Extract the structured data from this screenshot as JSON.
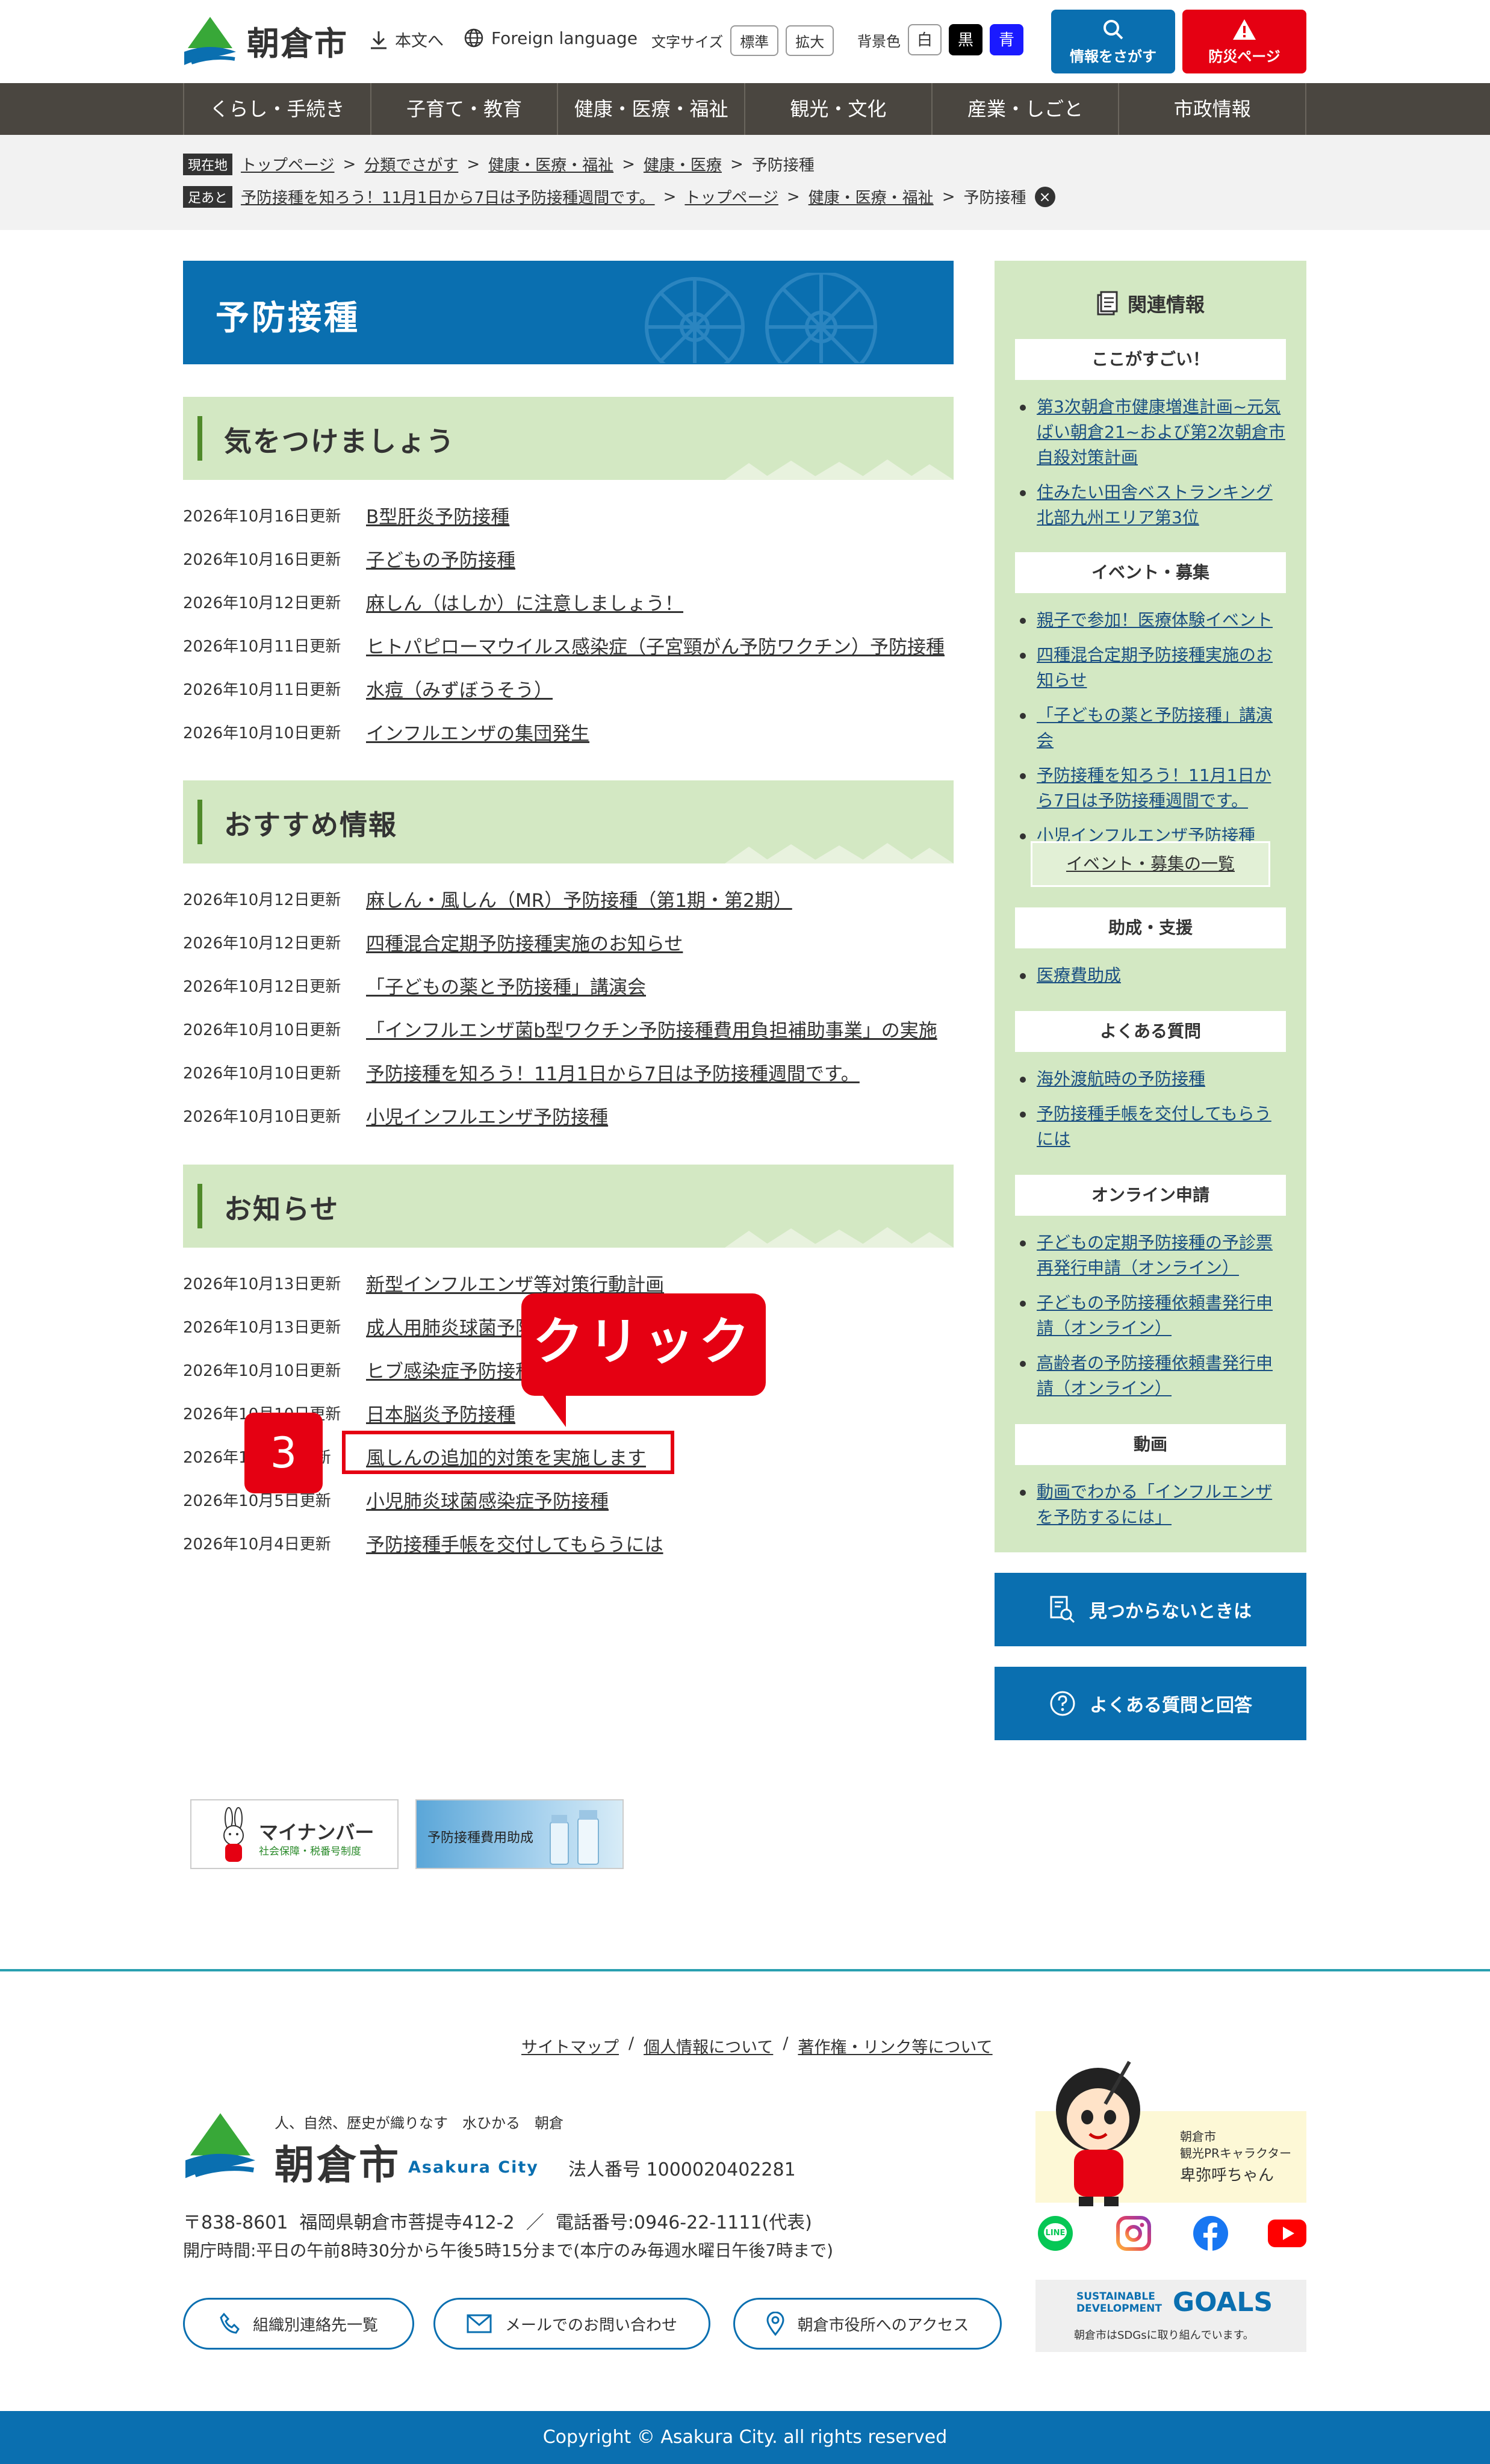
{
  "header": {
    "site_name": "朝倉市",
    "skip_main": "本文へ",
    "foreign": "Foreign language",
    "font_size_label": "文字サイズ",
    "font_standard": "標準",
    "font_large": "拡大",
    "bg_label": "背景色",
    "bg_white": "白",
    "bg_black": "黒",
    "bg_blue": "青",
    "search_btn": "情報をさがす",
    "disaster_btn": "防災ページ",
    "colors": {
      "blue": "#0a6fb0",
      "red": "#e50012",
      "green": "#d3e8c3"
    }
  },
  "nav": [
    "くらし・手続き",
    "子育て・教育",
    "健康・医療・福祉",
    "観光・文化",
    "産業・しごと",
    "市政情報"
  ],
  "breadcrumb": {
    "current_tag": "現在地",
    "current": [
      "トップページ",
      "分類でさがす",
      "健康・医療・福祉",
      "健康・医療"
    ],
    "current_last": "予防接種",
    "history_tag": "足あと",
    "history": [
      "予防接種を知ろう！11月1日から7日は予防接種週間です。",
      "トップページ",
      "健康・医療・福祉"
    ],
    "history_last": "予防接種",
    "sep": ">"
  },
  "page_title": "予防接種",
  "sections": [
    {
      "title": "気をつけましょう",
      "items": [
        {
          "date": "2026年10月16日更新",
          "text": "B型肝炎予防接種"
        },
        {
          "date": "2026年10月16日更新",
          "text": "子どもの予防接種"
        },
        {
          "date": "2026年10月12日更新",
          "text": "麻しん（はしか）に注意しましょう！"
        },
        {
          "date": "2026年10月11日更新",
          "text": "ヒトパピローマウイルス感染症（子宮頸がん予防ワクチン）予防接種"
        },
        {
          "date": "2026年10月11日更新",
          "text": "水痘（みずぼうそう）"
        },
        {
          "date": "2026年10月10日更新",
          "text": "インフルエンザの集団発生"
        }
      ]
    },
    {
      "title": "おすすめ情報",
      "items": [
        {
          "date": "2026年10月12日更新",
          "text": "麻しん・風しん（MR）予防接種（第1期・第2期）"
        },
        {
          "date": "2026年10月12日更新",
          "text": "四種混合定期予防接種実施のお知らせ"
        },
        {
          "date": "2026年10月12日更新",
          "text": "「子どもの薬と予防接種」講演会"
        },
        {
          "date": "2026年10月10日更新",
          "text": "「インフルエンザ菌b型ワクチン予防接種費用負担補助事業」の実施"
        },
        {
          "date": "2026年10月10日更新",
          "text": "予防接種を知ろう！11月1日から7日は予防接種週間です。"
        },
        {
          "date": "2026年10月10日更新",
          "text": "小児インフルエンザ予防接種"
        }
      ]
    },
    {
      "title": "お知らせ",
      "items": [
        {
          "date": "2026年10月13日更新",
          "text": "新型インフルエンザ等対策行動計画"
        },
        {
          "date": "2026年10月13日更新",
          "text": "成人用肺炎球菌予防接種"
        },
        {
          "date": "2026年10月10日更新",
          "text": "ヒブ感染症予防接種"
        },
        {
          "date": "2026年10月10日更新",
          "text": "日本脳炎予防接種"
        },
        {
          "date": "2026年10月6日更新",
          "text": "風しんの追加的対策を実施します"
        },
        {
          "date": "2026年10月5日更新",
          "text": "小児肺炎球菌感染症予防接種"
        },
        {
          "date": "2026年10月4日更新",
          "text": "予防接種手帳を交付してもらうには"
        }
      ]
    }
  ],
  "sidebar": {
    "title": "関連情報",
    "groups": [
      {
        "title": "ここがすごい！",
        "items": [
          "第3次朝倉市健康増進計画~元気ばい朝倉21~および第2次朝倉市自殺対策計画",
          "住みたい田舎ベストランキング 北部九州エリア第3位"
        ]
      },
      {
        "title": "イベント・募集",
        "items": [
          "親子で参加！医療体験イベント",
          "四種混合定期予防接種実施のお知らせ",
          "「子どもの薬と予防接種」講演会",
          "予防接種を知ろう！11月1日から7日は予防接種週間です。",
          "小児インフルエンザ予防接種"
        ]
      },
      {
        "title": "助成・支援",
        "items": [
          "医療費助成"
        ]
      },
      {
        "title": "よくある質問",
        "items": [
          "海外渡航時の予防接種",
          "予防接種手帳を交付してもらうには"
        ]
      },
      {
        "title": "オンライン申請",
        "items": [
          "子どもの定期予防接種の予診票再発行申請（オンライン）",
          "子どもの予防接種依頼書発行申請（オンライン）",
          "高齢者の予防接種依頼書発行申請（オンライン）"
        ]
      },
      {
        "title": "動画",
        "items": [
          "動画でわかる「インフルエンザを予防するには」"
        ]
      }
    ],
    "event_list_btn": "イベント・募集の一覧",
    "not_found_btn": "見つからないときは",
    "faq_btn": "よくある質問と回答"
  },
  "banners": {
    "mynumber_title": "マイナンバー",
    "mynumber_sub": "社会保障・税番号制度",
    "vaccine": "予防接種費用助成"
  },
  "footer": {
    "links": [
      "サイトマップ",
      "個人情報について",
      "著作権・リンク等について"
    ],
    "link_sep": "/",
    "tagline": "人、自然、歴史が織りなす　水ひかる　朝倉",
    "city": "朝倉市",
    "city_en": "Asakura City",
    "corp_no": "法人番号 1000020402281",
    "address": "〒838-8601  福岡県朝倉市菩提寺412-2  ／  電話番号:0946-22-1111(代表)",
    "hours": "開庁時間:平日の午前8時30分から午後5時15分まで(本庁のみ毎週水曜日午後7時まで)",
    "btn_contacts": "組織別連絡先一覧",
    "btn_mail": "メールでのお問い合わせ",
    "btn_access": "朝倉市役所へのアクセス",
    "mascot_city": "朝倉市",
    "mascot_role": "観光PRキャラクター",
    "mascot_name": "卑弥呼ちゃん",
    "sdgs_title1": "SUSTAINABLE",
    "sdgs_title2": "DEVELOPMENT",
    "sdgs_goals": "GOALS",
    "sdgs_note": "朝倉市はSDGsに取り組んでいます。",
    "copyright": "Copyright © Asakura City. all rights reserved"
  },
  "annotation": {
    "callout": "クリック",
    "step": "3"
  }
}
